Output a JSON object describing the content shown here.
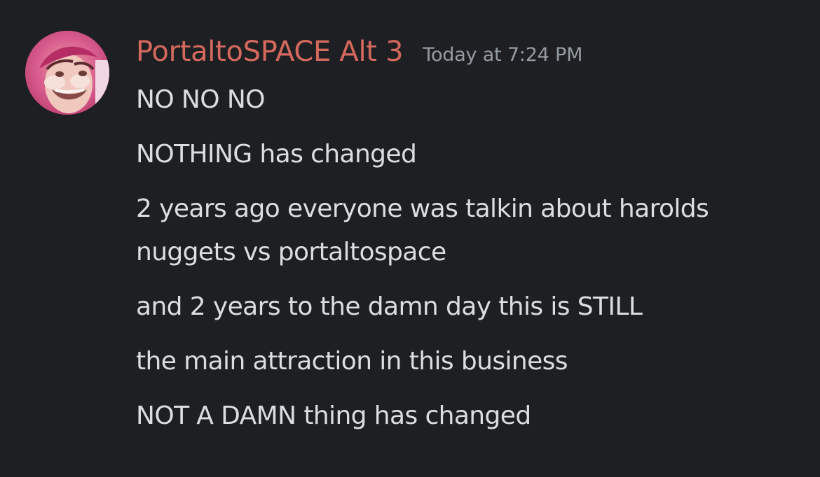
{
  "message": {
    "author": "PortaltoSPACE Alt 3",
    "timestamp": "Today at 7:24 PM",
    "author_color": "#d6695e",
    "lines": [
      "NO NO NO",
      "NOTHING has changed",
      "2 years ago everyone was talkin about harolds",
      "nuggets vs portaltospace",
      "and 2 years to the damn day this is STILL",
      "the main attraction in this business",
      "NOT A DAMN thing has changed"
    ]
  },
  "theme": {
    "background": "#1e1f22",
    "text": "#dbdee1",
    "muted": "#949ba4"
  },
  "avatar": {
    "icon": "user-avatar-photo"
  }
}
